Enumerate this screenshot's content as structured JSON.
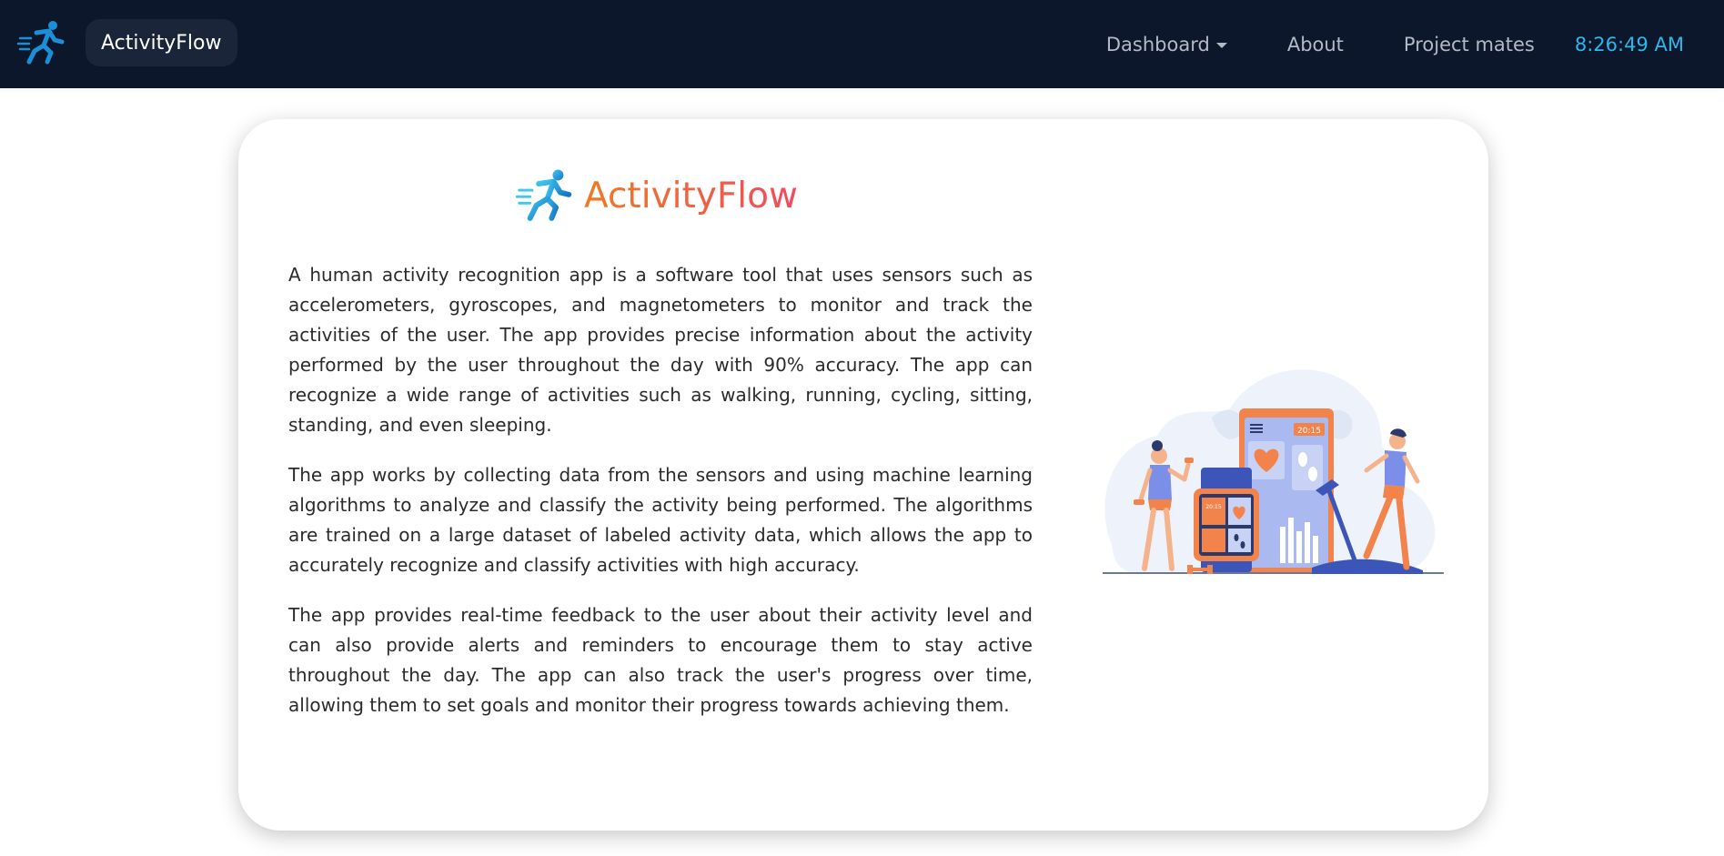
{
  "navbar": {
    "brand": "ActivityFlow",
    "logo_icon": "running-man-icon",
    "links": [
      {
        "label": "Dashboard",
        "has_dropdown": true
      },
      {
        "label": "About",
        "has_dropdown": false
      },
      {
        "label": "Project mates",
        "has_dropdown": false
      }
    ],
    "clock": "8:26:49 AM"
  },
  "card": {
    "title": "ActivityFlow",
    "title_colors": [
      "#ee7a23",
      "#f14a5f"
    ],
    "paragraphs": [
      "A human activity recognition app is a software tool that uses sensors such as accelerometers, gyroscopes, and magnetometers to monitor and track the activities of the user. The app provides precise information about the activity performed by the user throughout the day with 90% accuracy. The app can recognize a wide range of activities such as walking, running, cycling, sitting, standing, and even sleeping.",
      "The app works by collecting data from the sensors and using machine learning algorithms to analyze and classify the activity being performed. The algorithms are trained on a large dataset of labeled activity data, which allows the app to accurately recognize and classify activities with high accuracy.",
      "The app provides real-time feedback to the user about their activity level and can also provide alerts and reminders to encourage them to stay active throughout the day. The app can also track the user's progress over time, allowing them to set goals and monitor their progress towards achieving them."
    ],
    "illustration": {
      "icon": "fitness-tracking-illustration",
      "phone_time": "20:15",
      "watch_time": "20:15"
    }
  },
  "colors": {
    "navbar_bg": "#0d172b",
    "clock": "#2fb6e9",
    "logo_blue": "#1a8fd8"
  }
}
